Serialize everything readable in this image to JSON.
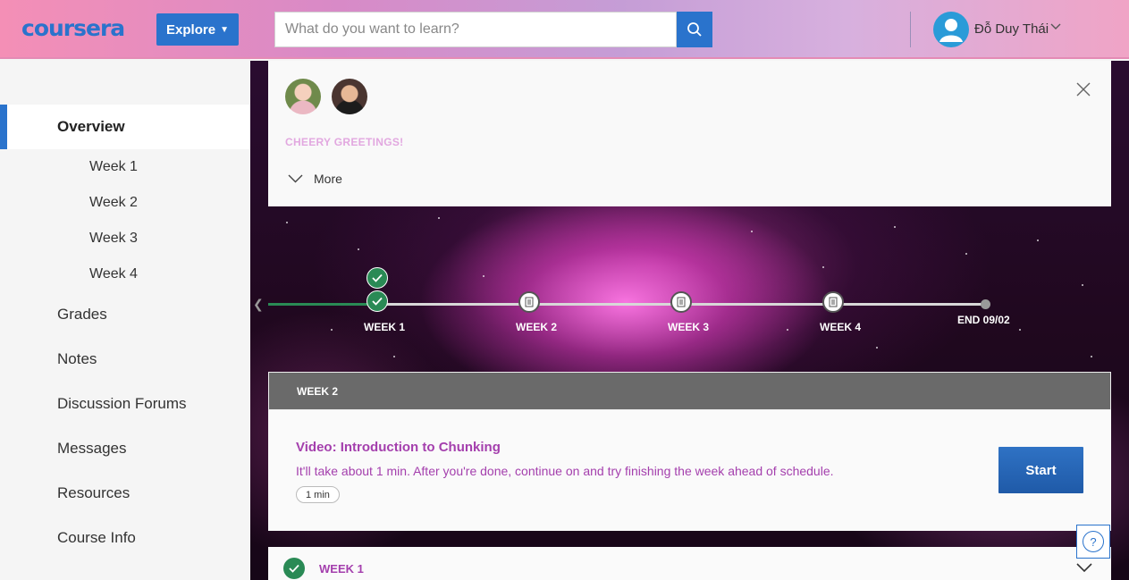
{
  "header": {
    "logo": "coursera",
    "explore_label": "Explore",
    "search_placeholder": "What do you want to learn?",
    "user_name": "Đỗ Duy Thái"
  },
  "sidebar": {
    "items": [
      {
        "label": "Overview"
      },
      {
        "label": "Week 1"
      },
      {
        "label": "Week 2"
      },
      {
        "label": "Week 3"
      },
      {
        "label": "Week 4"
      },
      {
        "label": "Grades"
      },
      {
        "label": "Notes"
      },
      {
        "label": "Discussion Forums"
      },
      {
        "label": "Messages"
      },
      {
        "label": "Resources"
      },
      {
        "label": "Course Info"
      }
    ]
  },
  "greeting": {
    "title": "CHEERY GREETINGS!",
    "more_label": "More"
  },
  "timeline": {
    "labels": [
      "WEEK 1",
      "WEEK 2",
      "WEEK 3",
      "WEEK 4",
      "END 09/02"
    ]
  },
  "current_week": {
    "title": "WEEK 2",
    "item_title": "Video: Introduction to Chunking",
    "item_desc": "It'll take about 1 min. After you're done, continue on and try finishing the week ahead of schedule.",
    "duration": "1 min",
    "start_label": "Start"
  },
  "week1": {
    "label": "WEEK 1"
  },
  "help": {
    "label": "?"
  },
  "colors": {
    "brand": "#2a73cc",
    "accent_purple": "#a43fad",
    "complete_green": "#2a8a55"
  }
}
